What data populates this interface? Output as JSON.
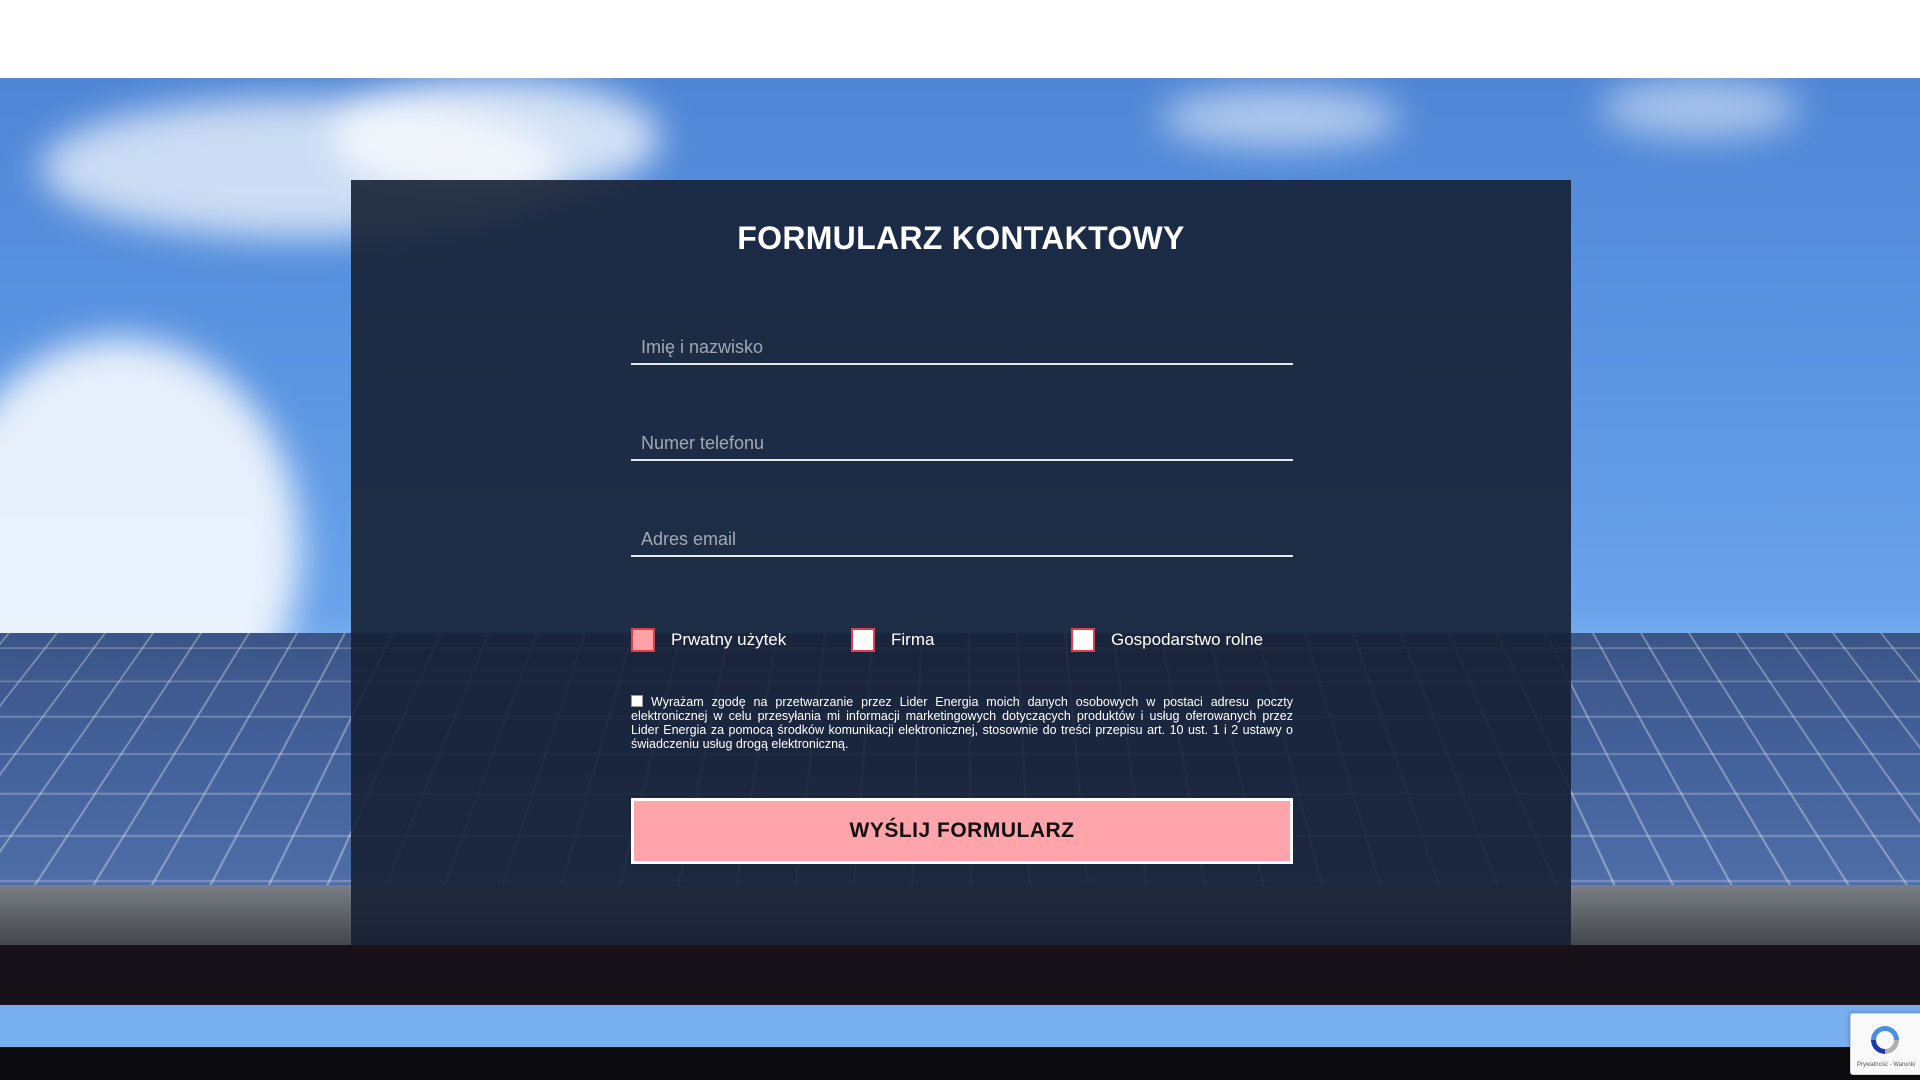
{
  "form": {
    "title": "FORMULARZ KONTAKTOWY",
    "fields": {
      "name_placeholder": "Imię i nazwisko",
      "phone_placeholder": "Numer telefonu",
      "email_placeholder": "Adres email"
    },
    "customer_types": [
      {
        "label": "Prwatny użytek",
        "checked": true
      },
      {
        "label": "Firma",
        "checked": false
      },
      {
        "label": "Gospodarstwo rolne",
        "checked": false
      }
    ],
    "consent_text": "Wyrażam zgodę na przetwarzanie przez Lider Energia moich danych osobowych w postaci adresu poczty elektronicznej w celu przesyłania mi informacji marketingowych dotyczących produktów i usług oferowanych przez Lider Energia za pomocą środków komunikacji elektronicznej, stosownie do treści przepisu art. 10 ust. 1 i 2 ustawy o świadczeniu usług drogą elektroniczną.",
    "submit_label": "WYŚLIJ FORMULARZ"
  },
  "recaptcha": {
    "footer_text": "Prywatność - Warunki"
  },
  "colors": {
    "card_bg": "#162034",
    "accent_pink": "#ffa4aa",
    "checkbox_border": "#e33d4a"
  },
  "icons": [
    "recaptcha-icon"
  ]
}
